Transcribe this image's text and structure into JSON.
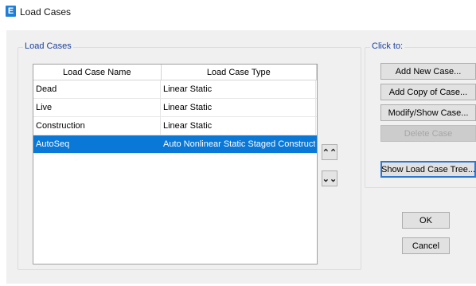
{
  "window": {
    "icon_letter": "E",
    "title": "Load Cases"
  },
  "load_cases_group": {
    "title": "Load Cases",
    "columns": [
      "Load Case Name",
      "Load Case Type"
    ],
    "rows": [
      {
        "name": "Dead",
        "type": "Linear Static",
        "selected": false
      },
      {
        "name": "Live",
        "type": "Linear Static",
        "selected": false
      },
      {
        "name": "Construction",
        "type": "Linear Static",
        "selected": false
      },
      {
        "name": "AutoSeq",
        "type": "Auto Nonlinear Static Staged Construction",
        "selected": true
      }
    ],
    "move_up_glyph": "⌃⌃",
    "move_down_glyph": "⌄⌄"
  },
  "click_to_group": {
    "title": "Click to:",
    "add_new": "Add New Case...",
    "add_copy": "Add Copy of Case...",
    "modify_show": "Modify/Show Case...",
    "delete": "Delete Case",
    "show_tree": "Show Load Case Tree..."
  },
  "footer": {
    "ok": "OK",
    "cancel": "Cancel"
  },
  "colors": {
    "selection": "#0a78d7",
    "group_title": "#1a3f9c",
    "dialog_bg": "#f0f0f0"
  }
}
